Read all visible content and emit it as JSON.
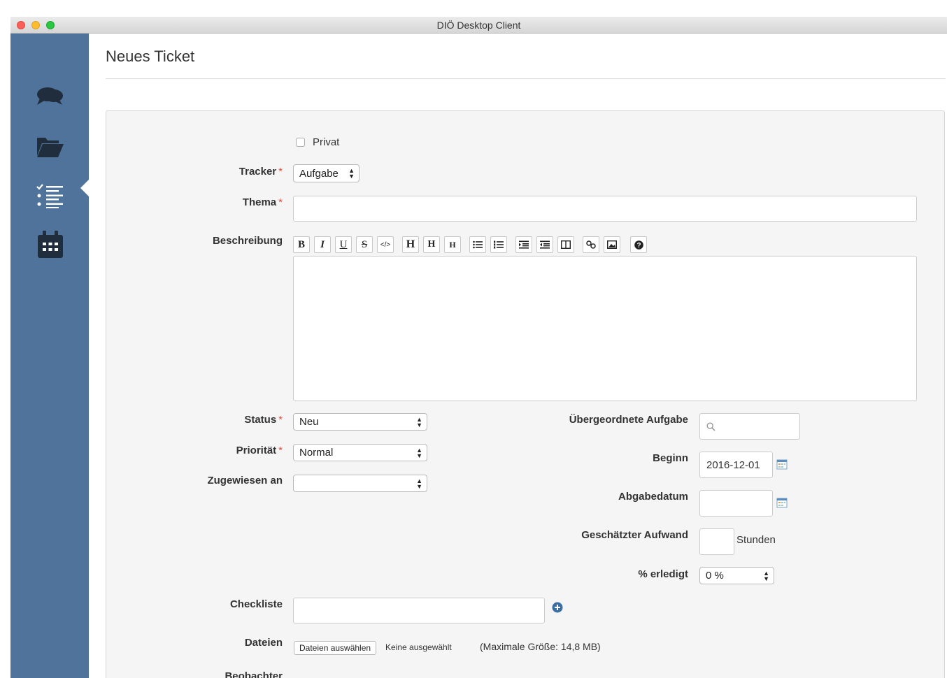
{
  "window": {
    "title": "DIÖ Desktop Client"
  },
  "sidebar": {
    "items": [
      {
        "name": "chat",
        "icon": "chat-bubbles-icon"
      },
      {
        "name": "projects",
        "icon": "folder-open-icon"
      },
      {
        "name": "tasks",
        "icon": "task-list-icon",
        "active": true
      },
      {
        "name": "calendar",
        "icon": "calendar-icon"
      }
    ]
  },
  "page": {
    "title": "Neues Ticket"
  },
  "form": {
    "privat_label": "Privat",
    "tracker": {
      "label": "Tracker",
      "required": "*",
      "value": "Aufgabe"
    },
    "thema": {
      "label": "Thema",
      "required": "*",
      "value": ""
    },
    "beschreibung": {
      "label": "Beschreibung",
      "toolbar": [
        "B",
        "I",
        "U",
        "S",
        "</>",
        "H",
        "H",
        "H"
      ],
      "value": ""
    },
    "status": {
      "label": "Status",
      "required": "*",
      "value": "Neu"
    },
    "prioritaet": {
      "label": "Priorität",
      "required": "*",
      "value": "Normal"
    },
    "zugewiesen": {
      "label": "Zugewiesen an",
      "value": ""
    },
    "uebergeordnet": {
      "label": "Übergeordnete Aufgabe",
      "value": ""
    },
    "beginn": {
      "label": "Beginn",
      "value": "2016-12-01"
    },
    "abgabedatum": {
      "label": "Abgabedatum",
      "value": ""
    },
    "aufwand": {
      "label": "Geschätzter Aufwand",
      "value": "",
      "unit": "Stunden"
    },
    "erledigt": {
      "label": "% erledigt",
      "value": "0 %"
    },
    "checkliste": {
      "label": "Checkliste",
      "value": ""
    },
    "dateien": {
      "label": "Dateien",
      "button": "Dateien auswählen",
      "status": "Keine ausgewählt",
      "hint": "(Maximale Größe: 14,8 MB)"
    },
    "beobachter": {
      "label": "Beobachter"
    }
  },
  "colors": {
    "sidebar": "#4f739b",
    "required": "#e74c3c",
    "accent_add": "#3a6ea5"
  }
}
